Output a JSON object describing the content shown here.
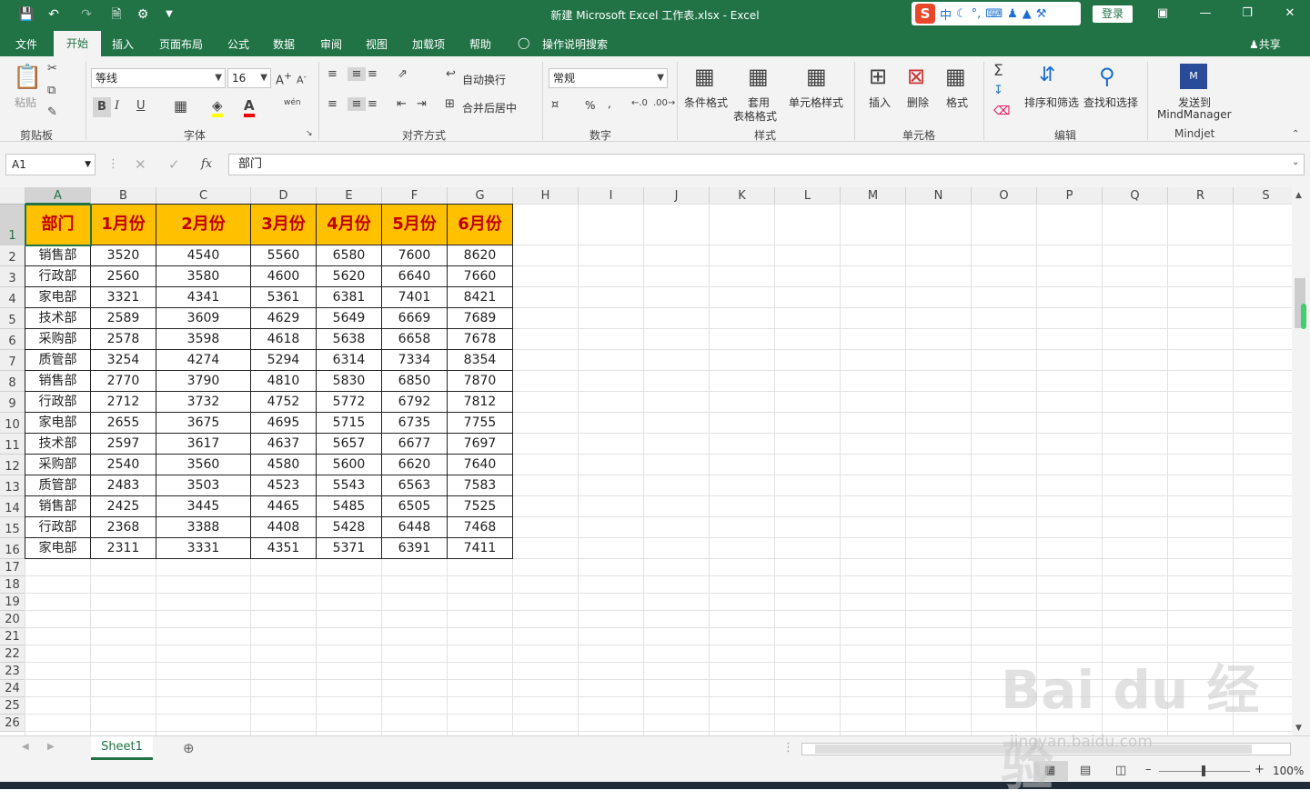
{
  "window": {
    "title": "新建 Microsoft Excel 工作表.xlsx  -  Excel",
    "login": "登录",
    "share": "共享"
  },
  "ime": {
    "logo": "S",
    "lang": "中"
  },
  "menu": {
    "tabs": [
      "文件",
      "开始",
      "插入",
      "页面布局",
      "公式",
      "数据",
      "审阅",
      "视图",
      "加载项",
      "帮助"
    ],
    "tell_me": "操作说明搜索"
  },
  "ribbon": {
    "clipboard": {
      "paste": "粘贴",
      "group": "剪贴板"
    },
    "font": {
      "name": "等线",
      "size": "16",
      "bold": "B",
      "italic": "I",
      "underline": "U",
      "group": "字体",
      "phonetic": "wén"
    },
    "align": {
      "wrap": "自动换行",
      "merge": "合并后居中",
      "group": "对齐方式"
    },
    "number": {
      "format": "常规",
      "percent": "%",
      "comma": ",",
      "group": "数字"
    },
    "styles": {
      "cond": "条件格式",
      "table1": "套用",
      "table2": "表格格式",
      "cell": "单元格样式",
      "group": "样式"
    },
    "cells": {
      "insert": "插入",
      "delete": "删除",
      "format": "格式",
      "group": "单元格"
    },
    "editing": {
      "sort": "排序和筛选",
      "find": "查找和选择",
      "group": "编辑"
    },
    "mindjet": {
      "send1": "发送到",
      "send2": "MindManager",
      "group": "Mindjet"
    }
  },
  "formula_bar": {
    "name_box": "A1",
    "fx": "fx",
    "content": "部门"
  },
  "columns": [
    "A",
    "B",
    "C",
    "D",
    "E",
    "F",
    "G",
    "H",
    "I",
    "J",
    "K",
    "L",
    "M",
    "N",
    "O",
    "P",
    "Q",
    "R",
    "S"
  ],
  "rows": [
    "1",
    "2",
    "3",
    "4",
    "5",
    "6",
    "7",
    "8",
    "9",
    "10",
    "11",
    "12",
    "13",
    "14",
    "15",
    "16",
    "17",
    "18",
    "19",
    "20",
    "21",
    "22",
    "23",
    "24",
    "25",
    "26"
  ],
  "table": {
    "headers": [
      "部门",
      "1月份",
      "2月份",
      "3月份",
      "4月份",
      "5月份",
      "6月份"
    ],
    "rows": [
      [
        "销售部",
        "3520",
        "4540",
        "5560",
        "6580",
        "7600",
        "8620"
      ],
      [
        "行政部",
        "2560",
        "3580",
        "4600",
        "5620",
        "6640",
        "7660"
      ],
      [
        "家电部",
        "3321",
        "4341",
        "5361",
        "6381",
        "7401",
        "8421"
      ],
      [
        "技术部",
        "2589",
        "3609",
        "4629",
        "5649",
        "6669",
        "7689"
      ],
      [
        "采购部",
        "2578",
        "3598",
        "4618",
        "5638",
        "6658",
        "7678"
      ],
      [
        "质管部",
        "3254",
        "4274",
        "5294",
        "6314",
        "7334",
        "8354"
      ],
      [
        "销售部",
        "2770",
        "3790",
        "4810",
        "5830",
        "6850",
        "7870"
      ],
      [
        "行政部",
        "2712",
        "3732",
        "4752",
        "5772",
        "6792",
        "7812"
      ],
      [
        "家电部",
        "2655",
        "3675",
        "4695",
        "5715",
        "6735",
        "7755"
      ],
      [
        "技术部",
        "2597",
        "3617",
        "4637",
        "5657",
        "6677",
        "7697"
      ],
      [
        "采购部",
        "2540",
        "3560",
        "4580",
        "5600",
        "6620",
        "7640"
      ],
      [
        "质管部",
        "2483",
        "3503",
        "4523",
        "5543",
        "6563",
        "7583"
      ],
      [
        "销售部",
        "2425",
        "3445",
        "4465",
        "5485",
        "6505",
        "7525"
      ],
      [
        "行政部",
        "2368",
        "3388",
        "4408",
        "5428",
        "6448",
        "7468"
      ],
      [
        "家电部",
        "2311",
        "3331",
        "4351",
        "5371",
        "6391",
        "7411"
      ]
    ],
    "header_fill": "#FFC000",
    "header_text": "#C00000"
  },
  "sheets": {
    "active": "Sheet1"
  },
  "status": {
    "zoom": "100%"
  },
  "watermark": {
    "brand": "Bai du 经验",
    "url": "jingyan.baidu.com"
  },
  "colors": {
    "accent": "#217346"
  }
}
